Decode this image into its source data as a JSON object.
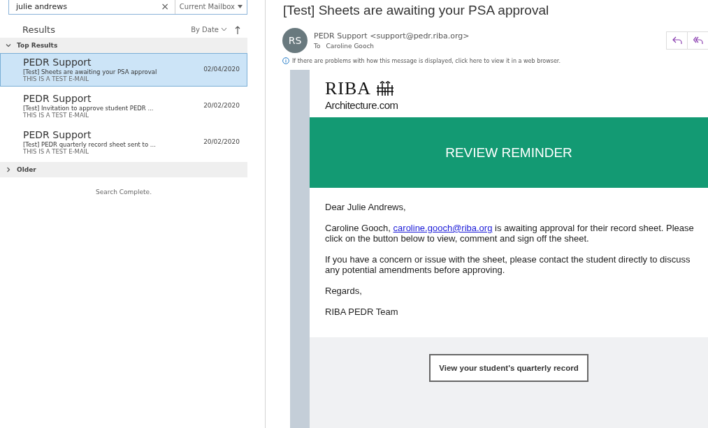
{
  "search": {
    "value": "julie andrews",
    "clear": "×",
    "scope": "Current Mailbox"
  },
  "results_header": {
    "title": "Results",
    "sort": "By Date"
  },
  "groups": [
    {
      "label": "Top Results",
      "expanded": true,
      "messages": [
        {
          "sender": "PEDR Support",
          "subject": "[Test] Sheets are awaiting your PSA approval",
          "preview": "THIS IS A TEST E-MAIL",
          "date": "02/04/2020",
          "selected": true
        },
        {
          "sender": "PEDR Support",
          "subject": "[Test] Invitation to approve student PEDR ...",
          "preview": "THIS IS A TEST E-MAIL",
          "date": "20/02/2020",
          "selected": false
        },
        {
          "sender": "PEDR Support",
          "subject": "[Test] PEDR quarterly record sheet sent to ...",
          "preview": "THIS IS A TEST E-MAIL",
          "date": "20/02/2020",
          "selected": false
        }
      ]
    },
    {
      "label": "Older",
      "expanded": false
    }
  ],
  "search_status": "Search Complete.",
  "message": {
    "subject": "[Test] Sheets are awaiting your PSA approval",
    "avatar": "RS",
    "from": "PEDR Support",
    "from_address": "<support@pedr.riba.org>",
    "to_label": "To",
    "to": "Caroline Gooch",
    "info": "If there are problems with how this message is displayed, click here to view it in a web browser.",
    "logo": "RIBA",
    "logo_sub": "Architecture.com",
    "banner": "REVIEW REMINDER",
    "greeting": "Dear Julie Andrews,",
    "paragraph": {
      "before": "Caroline Gooch,",
      "link": "caroline.gooch@riba.org",
      "after": "is awaiting approval for their record sheet. Please click on the button below to view, comment and sign off the sheet."
    },
    "paragraph_2": "If you have a concern or issue with the sheet, please contact the student directly to discuss any potential amendments before approving.",
    "closing": "Regards,",
    "signature": "RIBA PEDR Team",
    "button": "View your student's quarterly record"
  }
}
